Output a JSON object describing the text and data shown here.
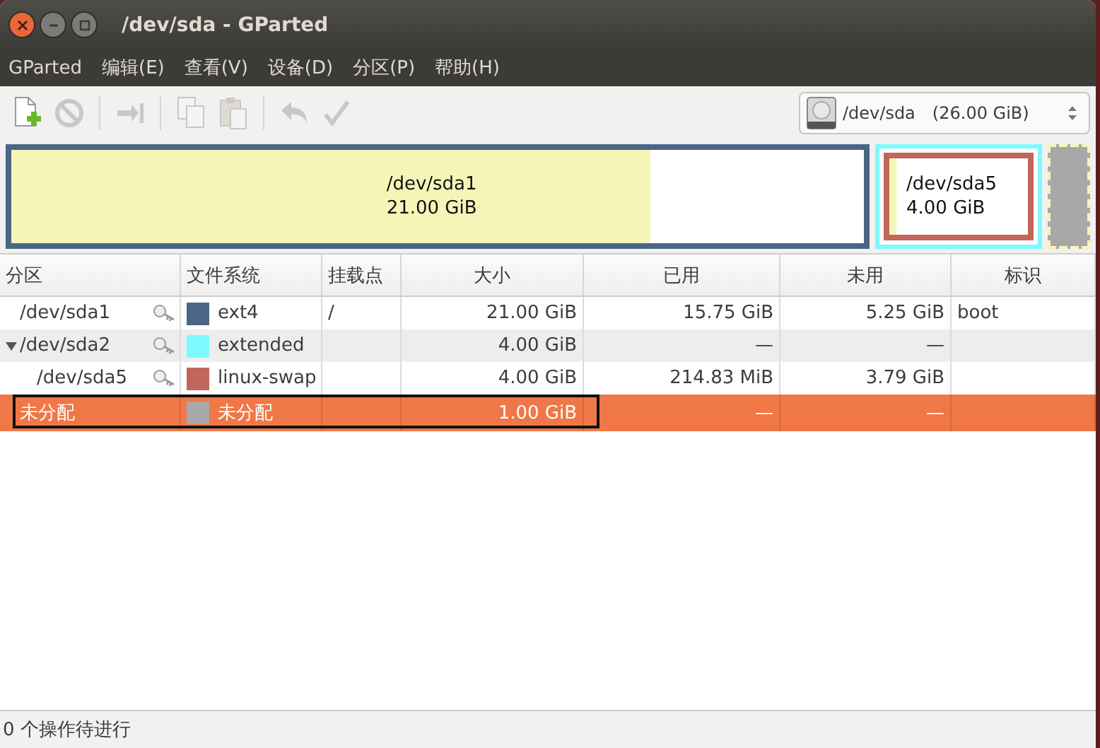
{
  "window": {
    "title": "/dev/sda - GParted"
  },
  "menu": [
    "GParted",
    "编辑(E)",
    "查看(V)",
    "设备(D)",
    "分区(P)",
    "帮助(H)"
  ],
  "toolbar": [
    {
      "kind": "new",
      "disabled": false
    },
    {
      "kind": "delete",
      "disabled": true
    },
    {
      "kind": "sep"
    },
    {
      "kind": "resize",
      "disabled": true
    },
    {
      "kind": "sep"
    },
    {
      "kind": "copy",
      "disabled": true
    },
    {
      "kind": "paste",
      "disabled": true
    },
    {
      "kind": "sep"
    },
    {
      "kind": "undo",
      "disabled": true
    },
    {
      "kind": "apply",
      "disabled": true
    }
  ],
  "device": {
    "name": "/dev/sda",
    "size": "(26.00 GiB)"
  },
  "disk_map": [
    {
      "kind": "primary",
      "name": "/dev/sda1",
      "size": "21.00 GiB",
      "color": "#4a6685",
      "level": 0.75
    },
    {
      "kind": "extended",
      "color": "#7dfaff",
      "children": [
        {
          "kind": "logical",
          "name": "/dev/sda5",
          "size": "4.00 GiB",
          "color": "#c1665a",
          "level": 0.05
        }
      ]
    },
    {
      "kind": "unallocated",
      "color": "#a8a8a8"
    }
  ],
  "table": {
    "columns": [
      "分区",
      "文件系统",
      "挂载点",
      "大小",
      "已用",
      "未用",
      "标识"
    ],
    "rows": [
      {
        "partition": "/dev/sda1",
        "locked": true,
        "filesystem": "ext4",
        "color": "#4a6685",
        "mount": "/",
        "size": "21.00 GiB",
        "used": "15.75 GiB",
        "unused": "5.25 GiB",
        "flags": "boot",
        "selected": false,
        "outlined": false
      },
      {
        "partition": "/dev/sda2",
        "locked": true,
        "filesystem": "extended",
        "color": "#7dfaff",
        "size": "4.00 GiB",
        "used": "—",
        "unused": "—",
        "selected": false,
        "outlined": false,
        "expanded": true,
        "children": [
          {
            "partition": "/dev/sda5",
            "locked": true,
            "filesystem": "linux-swap",
            "color": "#c1665a",
            "size": "4.00 GiB",
            "used": "214.83 MiB",
            "unused": "3.79 GiB",
            "selected": false,
            "outlined": false
          }
        ]
      },
      {
        "partition": "未分配",
        "locked": false,
        "filesystem": "未分配",
        "color": "#a8a8a8",
        "size": "1.00 GiB",
        "used": "—",
        "unused": "—",
        "selected": true,
        "outlined": true
      }
    ]
  },
  "status_bar": "0 个操作待进行"
}
